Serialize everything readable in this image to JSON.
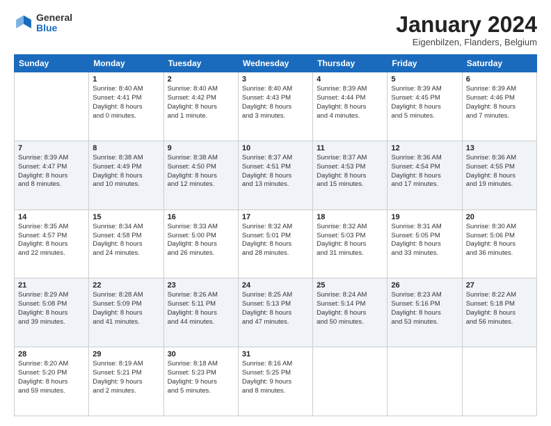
{
  "logo": {
    "general": "General",
    "blue": "Blue"
  },
  "title": "January 2024",
  "location": "Eigenbilzen, Flanders, Belgium",
  "weekdays": [
    "Sunday",
    "Monday",
    "Tuesday",
    "Wednesday",
    "Thursday",
    "Friday",
    "Saturday"
  ],
  "weeks": [
    [
      {
        "day": "",
        "info": ""
      },
      {
        "day": "1",
        "info": "Sunrise: 8:40 AM\nSunset: 4:41 PM\nDaylight: 8 hours\nand 0 minutes."
      },
      {
        "day": "2",
        "info": "Sunrise: 8:40 AM\nSunset: 4:42 PM\nDaylight: 8 hours\nand 1 minute."
      },
      {
        "day": "3",
        "info": "Sunrise: 8:40 AM\nSunset: 4:43 PM\nDaylight: 8 hours\nand 3 minutes."
      },
      {
        "day": "4",
        "info": "Sunrise: 8:39 AM\nSunset: 4:44 PM\nDaylight: 8 hours\nand 4 minutes."
      },
      {
        "day": "5",
        "info": "Sunrise: 8:39 AM\nSunset: 4:45 PM\nDaylight: 8 hours\nand 5 minutes."
      },
      {
        "day": "6",
        "info": "Sunrise: 8:39 AM\nSunset: 4:46 PM\nDaylight: 8 hours\nand 7 minutes."
      }
    ],
    [
      {
        "day": "7",
        "info": "Sunrise: 8:39 AM\nSunset: 4:47 PM\nDaylight: 8 hours\nand 8 minutes."
      },
      {
        "day": "8",
        "info": "Sunrise: 8:38 AM\nSunset: 4:49 PM\nDaylight: 8 hours\nand 10 minutes."
      },
      {
        "day": "9",
        "info": "Sunrise: 8:38 AM\nSunset: 4:50 PM\nDaylight: 8 hours\nand 12 minutes."
      },
      {
        "day": "10",
        "info": "Sunrise: 8:37 AM\nSunset: 4:51 PM\nDaylight: 8 hours\nand 13 minutes."
      },
      {
        "day": "11",
        "info": "Sunrise: 8:37 AM\nSunset: 4:53 PM\nDaylight: 8 hours\nand 15 minutes."
      },
      {
        "day": "12",
        "info": "Sunrise: 8:36 AM\nSunset: 4:54 PM\nDaylight: 8 hours\nand 17 minutes."
      },
      {
        "day": "13",
        "info": "Sunrise: 8:36 AM\nSunset: 4:55 PM\nDaylight: 8 hours\nand 19 minutes."
      }
    ],
    [
      {
        "day": "14",
        "info": "Sunrise: 8:35 AM\nSunset: 4:57 PM\nDaylight: 8 hours\nand 22 minutes."
      },
      {
        "day": "15",
        "info": "Sunrise: 8:34 AM\nSunset: 4:58 PM\nDaylight: 8 hours\nand 24 minutes."
      },
      {
        "day": "16",
        "info": "Sunrise: 8:33 AM\nSunset: 5:00 PM\nDaylight: 8 hours\nand 26 minutes."
      },
      {
        "day": "17",
        "info": "Sunrise: 8:32 AM\nSunset: 5:01 PM\nDaylight: 8 hours\nand 28 minutes."
      },
      {
        "day": "18",
        "info": "Sunrise: 8:32 AM\nSunset: 5:03 PM\nDaylight: 8 hours\nand 31 minutes."
      },
      {
        "day": "19",
        "info": "Sunrise: 8:31 AM\nSunset: 5:05 PM\nDaylight: 8 hours\nand 33 minutes."
      },
      {
        "day": "20",
        "info": "Sunrise: 8:30 AM\nSunset: 5:06 PM\nDaylight: 8 hours\nand 36 minutes."
      }
    ],
    [
      {
        "day": "21",
        "info": "Sunrise: 8:29 AM\nSunset: 5:08 PM\nDaylight: 8 hours\nand 39 minutes."
      },
      {
        "day": "22",
        "info": "Sunrise: 8:28 AM\nSunset: 5:09 PM\nDaylight: 8 hours\nand 41 minutes."
      },
      {
        "day": "23",
        "info": "Sunrise: 8:26 AM\nSunset: 5:11 PM\nDaylight: 8 hours\nand 44 minutes."
      },
      {
        "day": "24",
        "info": "Sunrise: 8:25 AM\nSunset: 5:13 PM\nDaylight: 8 hours\nand 47 minutes."
      },
      {
        "day": "25",
        "info": "Sunrise: 8:24 AM\nSunset: 5:14 PM\nDaylight: 8 hours\nand 50 minutes."
      },
      {
        "day": "26",
        "info": "Sunrise: 8:23 AM\nSunset: 5:16 PM\nDaylight: 8 hours\nand 53 minutes."
      },
      {
        "day": "27",
        "info": "Sunrise: 8:22 AM\nSunset: 5:18 PM\nDaylight: 8 hours\nand 56 minutes."
      }
    ],
    [
      {
        "day": "28",
        "info": "Sunrise: 8:20 AM\nSunset: 5:20 PM\nDaylight: 8 hours\nand 59 minutes."
      },
      {
        "day": "29",
        "info": "Sunrise: 8:19 AM\nSunset: 5:21 PM\nDaylight: 9 hours\nand 2 minutes."
      },
      {
        "day": "30",
        "info": "Sunrise: 8:18 AM\nSunset: 5:23 PM\nDaylight: 9 hours\nand 5 minutes."
      },
      {
        "day": "31",
        "info": "Sunrise: 8:16 AM\nSunset: 5:25 PM\nDaylight: 9 hours\nand 8 minutes."
      },
      {
        "day": "",
        "info": ""
      },
      {
        "day": "",
        "info": ""
      },
      {
        "day": "",
        "info": ""
      }
    ]
  ]
}
